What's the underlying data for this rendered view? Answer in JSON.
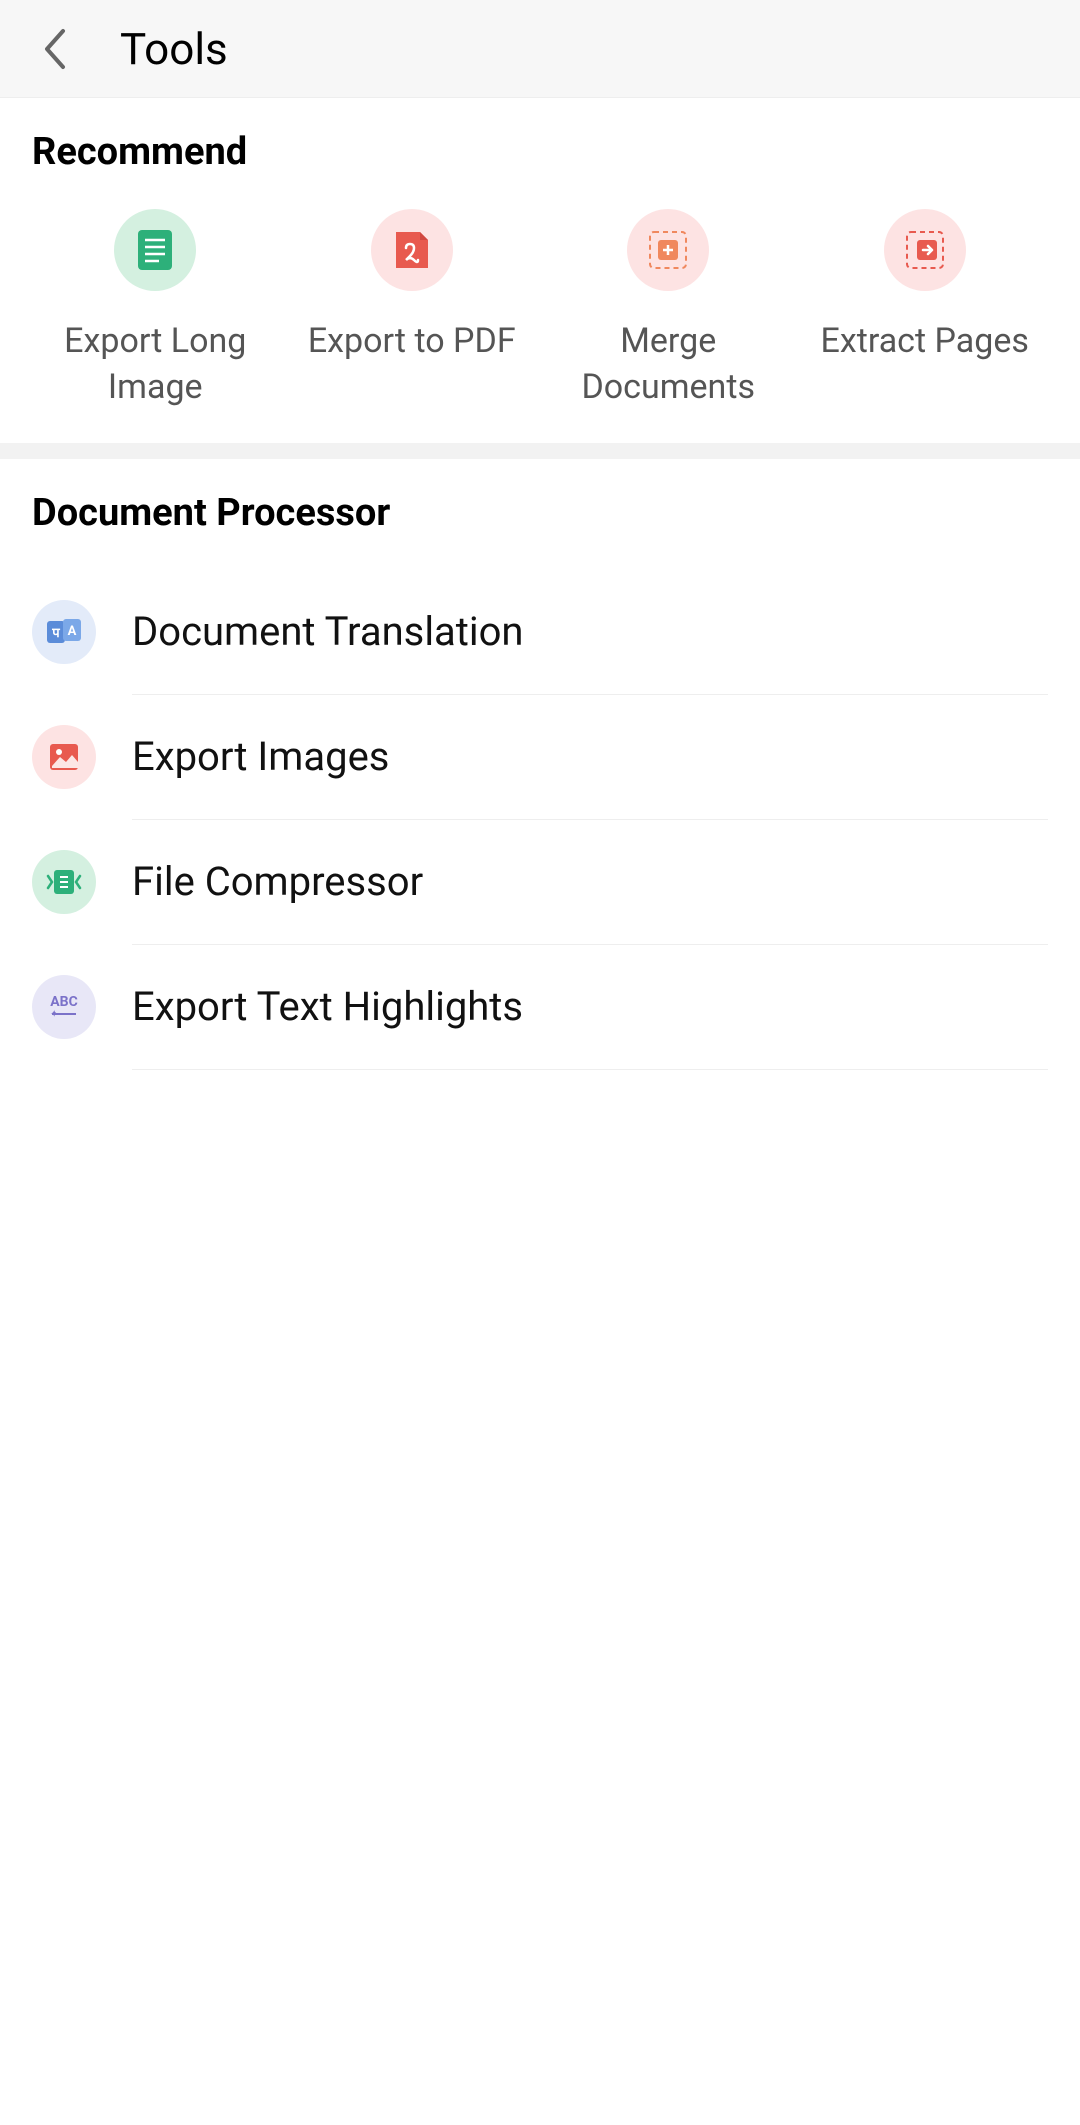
{
  "header": {
    "title": "Tools"
  },
  "recommend": {
    "title": "Recommend",
    "items": [
      {
        "label": "Export Long Image"
      },
      {
        "label": "Export to PDF"
      },
      {
        "label": "Merge Documents"
      },
      {
        "label": "Extract Pages"
      }
    ]
  },
  "processor": {
    "title": "Document Processor",
    "items": [
      {
        "label": "Document Translation"
      },
      {
        "label": "Export Images"
      },
      {
        "label": "File Compressor"
      },
      {
        "label": "Export Text Highlights"
      }
    ]
  }
}
